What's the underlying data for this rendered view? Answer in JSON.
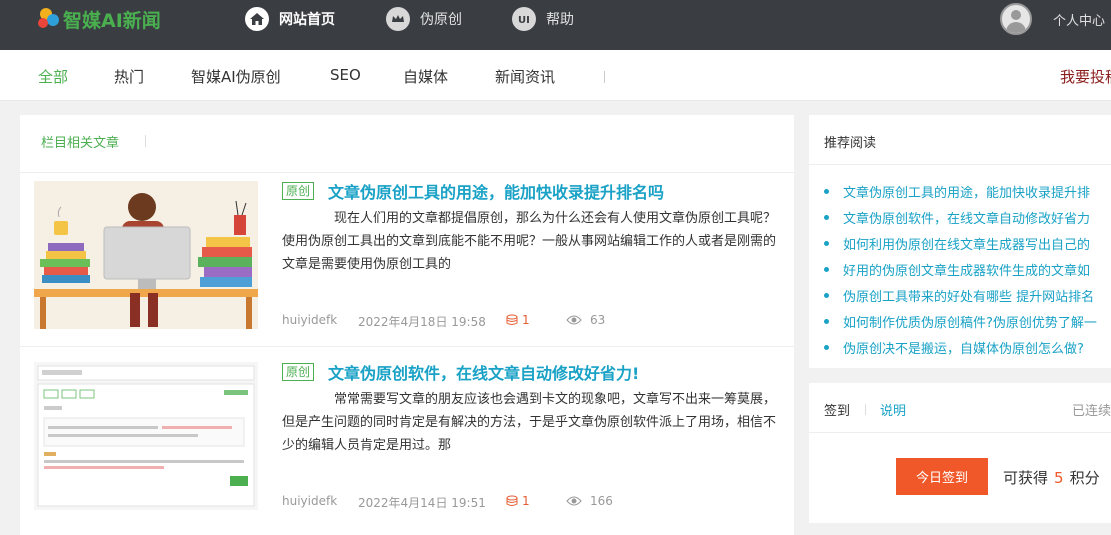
{
  "header": {
    "logo_text": "智媒AI新闻",
    "nav": [
      {
        "label": "网站首页",
        "icon": "home-icon"
      },
      {
        "label": "伪原创",
        "icon": "crown-icon"
      },
      {
        "label": "帮助",
        "icon": "ui-icon"
      }
    ],
    "user_center": "个人中心"
  },
  "categories": {
    "items": [
      "全部",
      "热门",
      "智媒AI伪原创",
      "SEO",
      "自媒体",
      "新闻资讯"
    ],
    "active": "全部",
    "submit_label": "我要投稿"
  },
  "main": {
    "heading": "栏目相关文章",
    "articles": [
      {
        "badge": "原创",
        "title": "文章伪原创工具的用途，能加快收录提升排名吗",
        "excerpt": "现在人们用的文章都提倡原创，那么为什么还会有人使用文章伪原创工具呢？使用伪原创工具出的文章到底能不能不用呢？一般从事网站编辑工作的人或者是刚需的文章是需要使用伪原创工具的",
        "author": "huiyidefk",
        "date": "2022年4月18日 19:58",
        "comments": "1",
        "views": "63"
      },
      {
        "badge": "原创",
        "title": "文章伪原创软件，在线文章自动修改好省力!",
        "excerpt": "常常需要写文章的朋友应该也会遇到卡文的现象吧，文章写不出来一筹莫展，但是产生问题的同时肯定是有解决的方法，于是乎文章伪原创软件派上了用场，相信不少的编辑人员肯定是用过。那",
        "author": "huiyidefk",
        "date": "2022年4月14日 19:51",
        "comments": "1",
        "views": "166"
      }
    ]
  },
  "sidebar": {
    "recommended_heading": "推荐阅读",
    "recommended": [
      "文章伪原创工具的用途，能加快收录提升排",
      "文章伪原创软件，在线文章自动修改好省力",
      "如何利用伪原创在线文章生成器写出自己的",
      "好用的伪原创文章生成器软件生成的文章如",
      "伪原创工具带来的好处有哪些 提升网站排名",
      "如何制作优质伪原创稿件?伪原创优势了解一",
      "伪原创决不是搬运，自媒体伪原创怎么做?"
    ],
    "checkin": {
      "tab_checkin": "签到",
      "tab_info": "说明",
      "streak_label": "已连续",
      "button_label": "今日签到",
      "gain_prefix": "可获得",
      "gain_points": "5",
      "gain_suffix": "积分"
    }
  },
  "colors": {
    "topbar": "#3a3d42",
    "accent_green": "#4caf50",
    "link_blue": "#19a2c6",
    "button_orange": "#f0582a"
  }
}
